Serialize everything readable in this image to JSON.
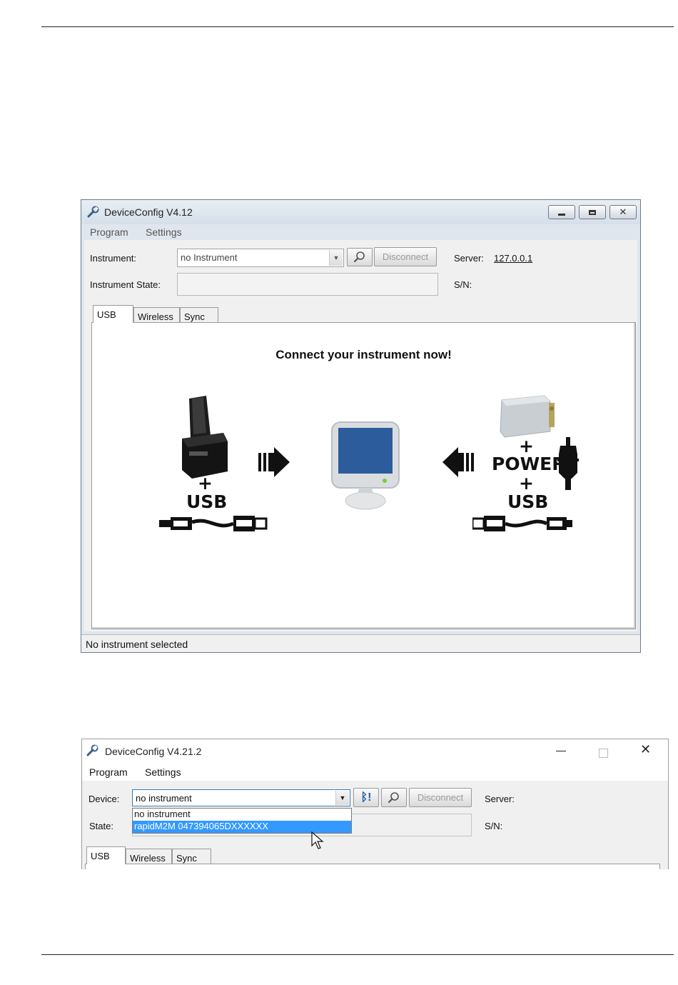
{
  "window1": {
    "title": "DeviceConfig V4.12",
    "menu": [
      "Program",
      "Settings"
    ],
    "instrument_label": "Instrument:",
    "instrument_value": "no Instrument",
    "disconnect_label": "Disconnect",
    "server_label": "Server:",
    "server_value": "127.0.0.1",
    "instrument_state_label": "Instrument State:",
    "sn_label": "S/N:",
    "tabs": [
      "USB",
      "Wireless",
      "Sync"
    ],
    "headline": "Connect your instrument now!",
    "left_plus": "+",
    "left_usb": "USB",
    "right_plus_1": "+",
    "right_power": "POWER",
    "right_plus_2": "+",
    "right_usb": "USB",
    "status_text": "No instrument selected"
  },
  "window2": {
    "title": "DeviceConfig V4.21.2",
    "menu": [
      "Program",
      "Settings"
    ],
    "device_label": "Device:",
    "device_value": "no instrument",
    "disconnect_label": "Disconnect",
    "server_label": "Server:",
    "state_label": "State:",
    "sn_label": "S/N:",
    "dropdown_options": [
      "no instrument",
      "rapidM2M 047394065DXXXXXX"
    ],
    "tabs": [
      "USB",
      "Wireless",
      "Sync"
    ]
  }
}
